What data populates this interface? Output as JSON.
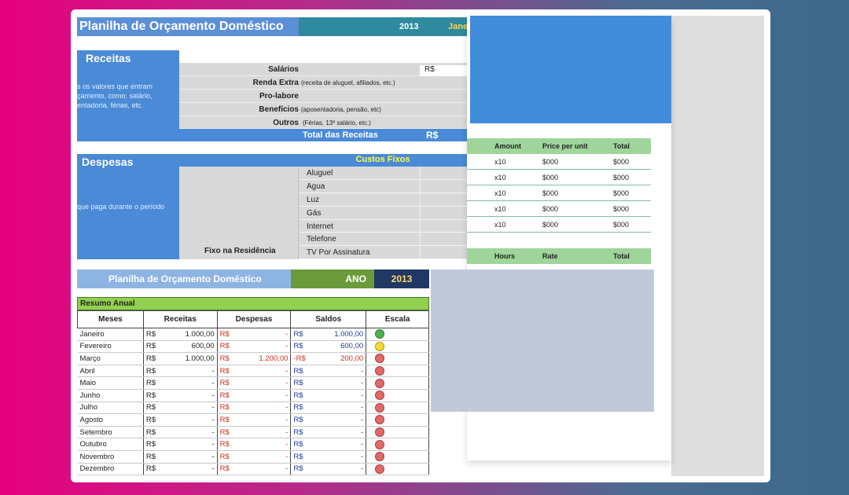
{
  "back_sheet": {
    "title": "Planilha de Orçamento Doméstico",
    "year": "2013",
    "month_partial": "Jane",
    "receitas": {
      "title": "Receitas",
      "note_lines": [
        "s os valores que entram",
        "çamento, como: salário,",
        "entadoria, férias, etc."
      ],
      "rows": [
        {
          "label": "Salários",
          "note": "",
          "value": "R$"
        },
        {
          "label": "Renda Extra",
          "note": "(receita de aluguel, afiliados, etc.)",
          "value": ""
        },
        {
          "label": "Pro-labore",
          "note": "",
          "value": ""
        },
        {
          "label": "Benefícios",
          "note": "(aposentadoria, pensão, etc)",
          "value": ""
        },
        {
          "label": "Outros",
          "note": "(Férias, 13º salário, etc.)",
          "value": ""
        }
      ],
      "total_label": "Total das Receitas",
      "total_value": "R$"
    },
    "despesas": {
      "title": "Despesas",
      "note": "que paga durante o período",
      "custos_fixos": "Custos Fixos",
      "group_label": "Fixo na Residência",
      "items": [
        "Aluguel",
        "Agua",
        "Luz",
        "Gás",
        "Internet",
        "Telefone",
        "TV Por Assinatura"
      ]
    }
  },
  "overlay_table": {
    "headers": [
      "Amount",
      "Price per unit",
      "Total"
    ],
    "rows": [
      [
        "x10",
        "$000",
        "$000"
      ],
      [
        "x10",
        "$000",
        "$000"
      ],
      [
        "x10",
        "$000",
        "$000"
      ],
      [
        "x10",
        "$000",
        "$000"
      ],
      [
        "x10",
        "$000",
        "$000"
      ]
    ],
    "headers2": [
      "Hours",
      "Rate",
      "Total"
    ]
  },
  "front_sheet": {
    "title": "Planilha de Orçamento Doméstico",
    "ano_label": "ANO",
    "year": "2013",
    "summary_title": "Resumo Anual",
    "columns": [
      "Meses",
      "Receitas",
      "Despesas",
      "Saldos",
      "Escala"
    ],
    "currency": "R$",
    "rows": [
      {
        "month": "Janeiro",
        "receitas": "1.000,00",
        "despesas": "-",
        "saldo_sign": "",
        "saldo": "1.000,00",
        "scale": "green"
      },
      {
        "month": "Fevereiro",
        "receitas": "600,00",
        "despesas": "-",
        "saldo_sign": "",
        "saldo": "600,00",
        "scale": "yellow"
      },
      {
        "month": "Março",
        "receitas": "1.000,00",
        "despesas": "1.200,00",
        "saldo_sign": "-",
        "saldo": "200,00",
        "scale": "red"
      },
      {
        "month": "Abril",
        "receitas": "-",
        "despesas": "-",
        "saldo_sign": "",
        "saldo": "-",
        "scale": "red"
      },
      {
        "month": "Maio",
        "receitas": "-",
        "despesas": "-",
        "saldo_sign": "",
        "saldo": "-",
        "scale": "red"
      },
      {
        "month": "Junho",
        "receitas": "-",
        "despesas": "-",
        "saldo_sign": "",
        "saldo": "-",
        "scale": "red"
      },
      {
        "month": "Julho",
        "receitas": "-",
        "despesas": "-",
        "saldo_sign": "",
        "saldo": "-",
        "scale": "red"
      },
      {
        "month": "Agosto",
        "receitas": "-",
        "despesas": "-",
        "saldo_sign": "",
        "saldo": "-",
        "scale": "red"
      },
      {
        "month": "Setembro",
        "receitas": "-",
        "despesas": "-",
        "saldo_sign": "",
        "saldo": "-",
        "scale": "red"
      },
      {
        "month": "Outubro",
        "receitas": "-",
        "despesas": "-",
        "saldo_sign": "",
        "saldo": "-",
        "scale": "red"
      },
      {
        "month": "Novembro",
        "receitas": "-",
        "despesas": "-",
        "saldo_sign": "",
        "saldo": "-",
        "scale": "red"
      },
      {
        "month": "Dezembro",
        "receitas": "-",
        "despesas": "-",
        "saldo_sign": "",
        "saldo": "-",
        "scale": "red"
      }
    ]
  },
  "colors": {
    "background_from": "#e6007e",
    "background_to": "#3e6a8c",
    "sheet_blue": "#4a8ad6",
    "header_green": "#9fd59b",
    "summary_green": "#92d050",
    "year_navy": "#1f3864",
    "year_text": "#ffd966"
  }
}
